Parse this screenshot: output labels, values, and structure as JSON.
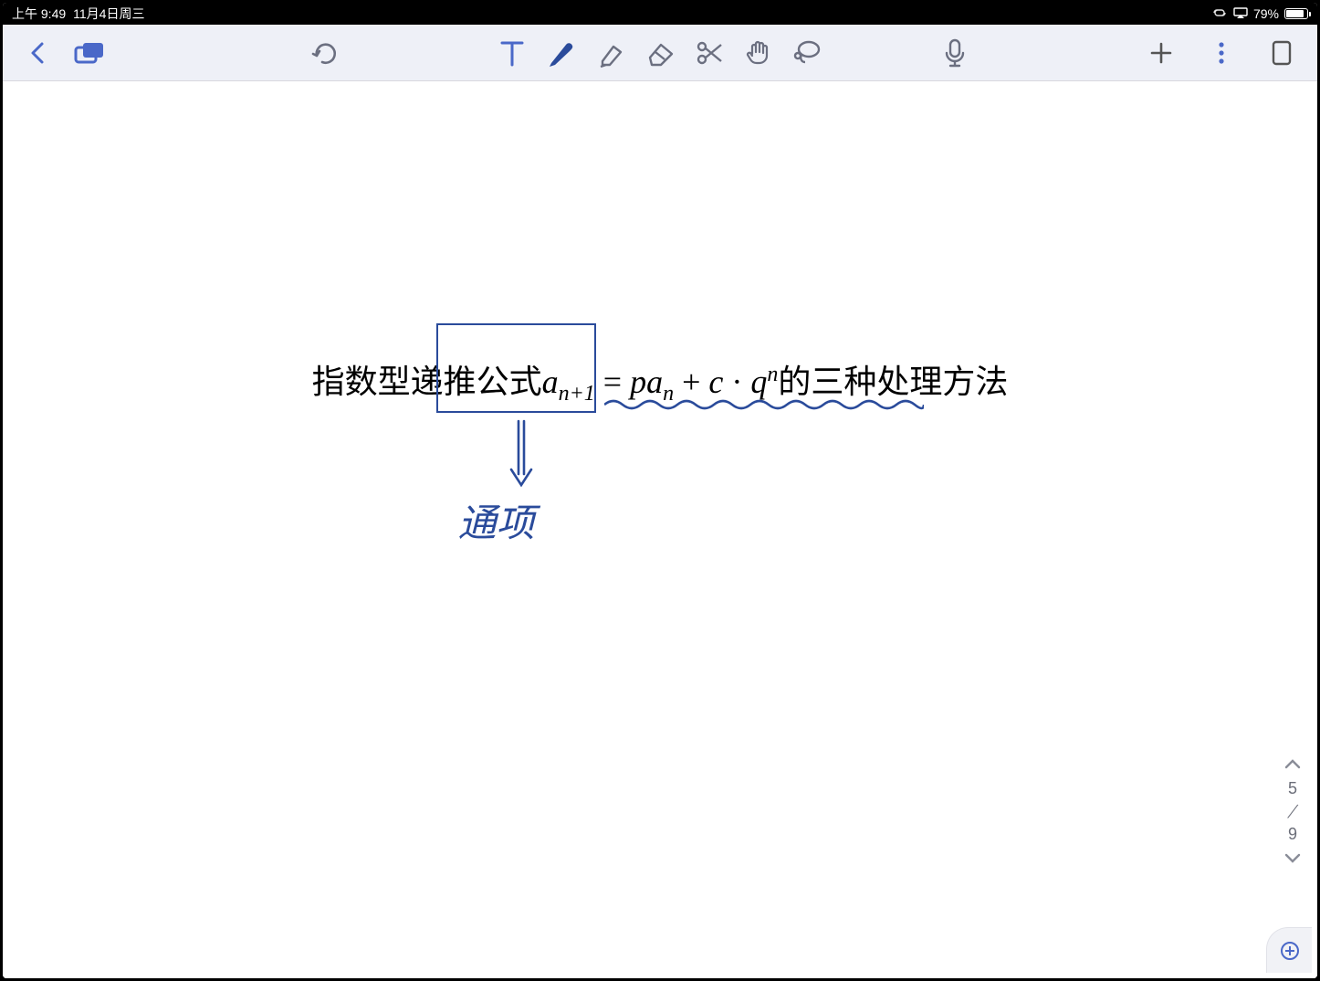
{
  "status_bar": {
    "time": "上午 9:49",
    "date": "11月4日周三",
    "battery_text": "79%"
  },
  "toolbar": {
    "back": "back",
    "tabs": "tabs",
    "undo": "undo",
    "text_tool": "T",
    "pen": "pen",
    "highlighter": "highlighter",
    "eraser": "eraser",
    "scissors": "scissors",
    "lasso_hand": "hand",
    "lasso": "lasso",
    "mic": "mic",
    "add": "add",
    "more": "more",
    "page_view": "page-view"
  },
  "content": {
    "prefix_text": "指数型",
    "boxed_text": "递推公式",
    "formula_a": "a",
    "formula_sub1": "n+1",
    "formula_eq": " = ",
    "formula_p": "p",
    "formula_a2": "a",
    "formula_sub2": "n",
    "formula_plus": " + ",
    "formula_c": "c",
    "formula_dot": " · ",
    "formula_q": "q",
    "formula_supn": "n",
    "suffix_text": "的三种处理方法",
    "handwritten_note": "通项"
  },
  "pager": {
    "current": "5",
    "total": "9"
  }
}
